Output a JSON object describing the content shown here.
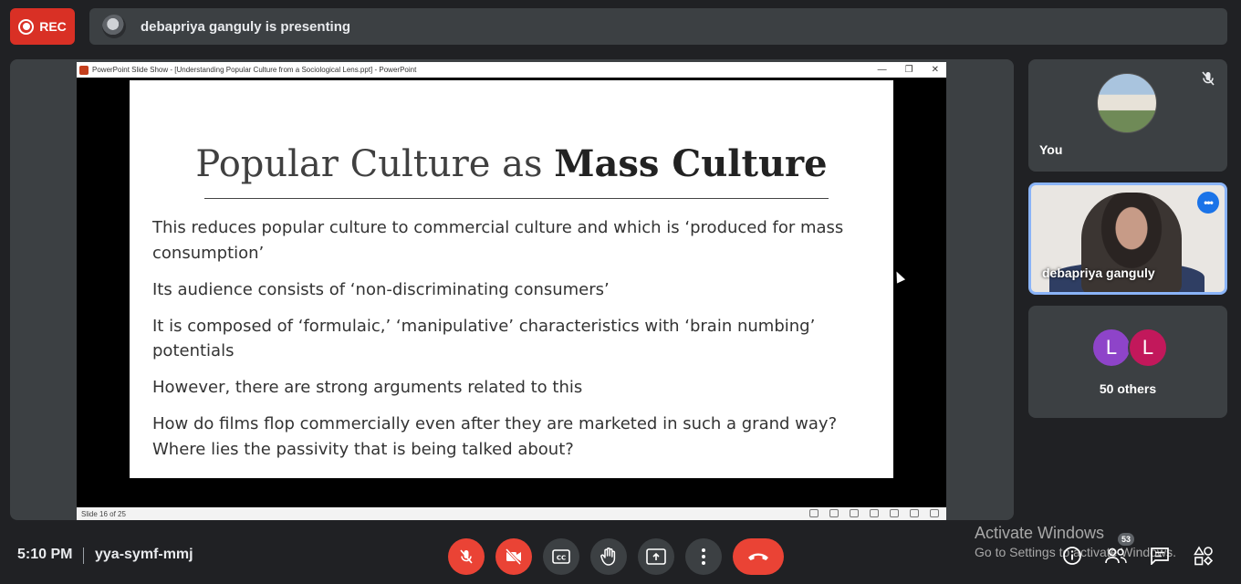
{
  "top": {
    "rec_label": "REC",
    "presenting_text": "debapriya ganguly is presenting"
  },
  "ppt": {
    "window_title": "PowerPoint Slide Show - [Understanding Popular Culture from a Sociological Lens.ppt] - PowerPoint",
    "status": "Slide 16 of 25",
    "minimize": "—",
    "restore": "❐",
    "close": "✕"
  },
  "slide": {
    "title_plain": "Popular Culture as ",
    "title_bold": "Mass Culture",
    "bullets": [
      "This reduces popular culture to commercial culture and which is ‘produced for mass consumption’",
      "Its audience consists of ‘non-discriminating consumers’",
      "It is composed of ‘formulaic,’ ‘manipulative’ characteristics with ‘brain numbing’ potentials",
      "However, there are strong arguments related to this",
      "How do films flop commercially even after they are marketed in such a grand way? Where lies the passivity that is being talked about?"
    ]
  },
  "participants": {
    "you_label": "You",
    "presenter_name": "debapriya ganguly",
    "others_initial_1": "L",
    "others_initial_2": "L",
    "others_label": "50 others"
  },
  "bottom": {
    "time": "5:10 PM",
    "meeting_code": "yya-symf-mmj",
    "people_count": "53",
    "watermark_line1": "Activate Windows",
    "watermark_line2": "Go to Settings to activate Windows."
  },
  "icons": {
    "mic_off": "mic-off-icon",
    "camera_off": "camera-off-icon",
    "captions": "captions-icon",
    "raise_hand": "hand-icon",
    "present": "present-screen-icon",
    "more": "more-vert-icon",
    "end_call": "end-call-icon",
    "info": "info-icon",
    "people": "people-icon",
    "chat": "chat-icon",
    "activities": "activities-icon"
  },
  "colors": {
    "background": "#202124",
    "tile": "#3c4043",
    "danger": "#ea4335",
    "accent": "#8ab4f8",
    "blue_button": "#1a73e8"
  }
}
